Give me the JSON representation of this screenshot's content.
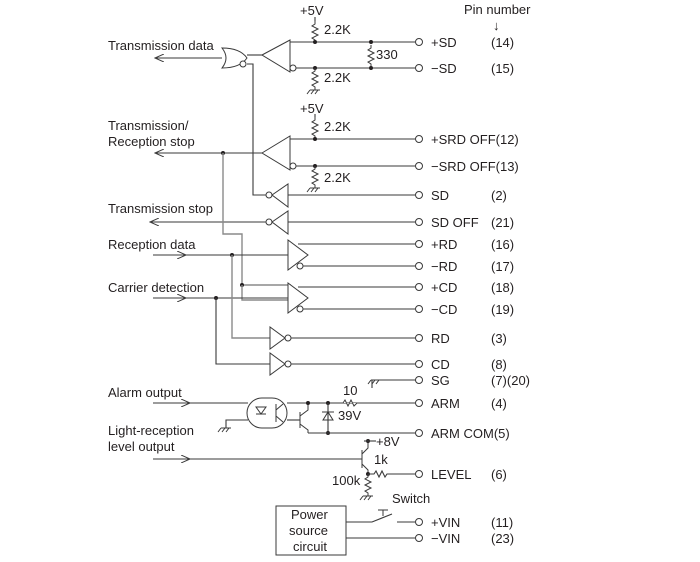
{
  "diagram": {
    "header": {
      "pin_number_label": "Pin number",
      "arrow": "↓"
    },
    "inputs": {
      "transmission_data": "Transmission data",
      "tx_rx_stop_line1": "Transmission/",
      "tx_rx_stop_line2": "Reception stop",
      "transmission_stop": "Transmission stop",
      "reception_data": "Reception data",
      "carrier_detection": "Carrier detection",
      "alarm_output": "Alarm output",
      "light_level_line1": "Light-reception",
      "light_level_line2": "level output"
    },
    "components": {
      "vcc1": "+5V",
      "r_pullup1": "2.2K",
      "r_term": "330",
      "r_pulldown1": "2.2K",
      "vcc2": "+5V",
      "r_pullup2": "2.2K",
      "r_pulldown2": "2.2K",
      "r_alarm": "10",
      "zener": "39V",
      "vcc3": "+8V",
      "r_level": "1k",
      "r_level_pd": "100k",
      "switch": "Switch",
      "power_line1": "Power",
      "power_line2": "source",
      "power_line3": "circuit"
    },
    "pins": [
      {
        "signal": "+SD",
        "pin": "(14)"
      },
      {
        "signal": "−SD",
        "pin": "(15)"
      },
      {
        "signal": "+SRD OFF(12)",
        "pin": ""
      },
      {
        "signal": "−SRD OFF(13)",
        "pin": ""
      },
      {
        "signal": "SD",
        "pin": "(2)"
      },
      {
        "signal": "SD OFF",
        "pin": "(21)"
      },
      {
        "signal": "+RD",
        "pin": "(16)"
      },
      {
        "signal": "−RD",
        "pin": "(17)"
      },
      {
        "signal": "+CD",
        "pin": "(18)"
      },
      {
        "signal": "−CD",
        "pin": "(19)"
      },
      {
        "signal": "RD",
        "pin": "(3)"
      },
      {
        "signal": "CD",
        "pin": "(8)"
      },
      {
        "signal": "SG",
        "pin": "(7)(20)"
      },
      {
        "signal": "ARM",
        "pin": "(4)"
      },
      {
        "signal": "ARM COM(5)",
        "pin": ""
      },
      {
        "signal": "LEVEL",
        "pin": "(6)"
      },
      {
        "signal": "+VIN",
        "pin": "(11)"
      },
      {
        "signal": "−VIN",
        "pin": "(23)"
      }
    ]
  }
}
